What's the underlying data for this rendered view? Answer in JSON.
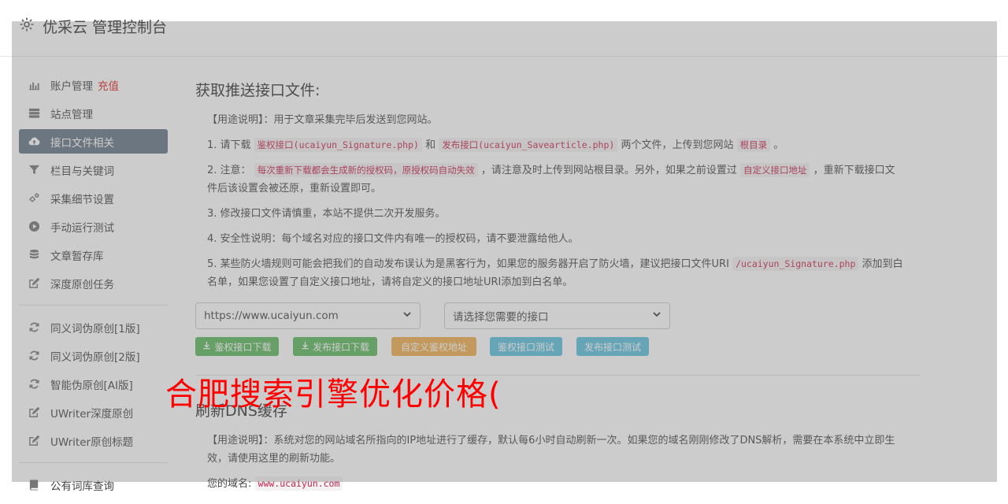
{
  "header": {
    "brand": "优采云 管理控制台"
  },
  "sidebar": {
    "group1": [
      {
        "label": "账户管理",
        "badge": "充值",
        "icon": "bar-chart-icon"
      },
      {
        "label": "站点管理",
        "icon": "server-icon"
      },
      {
        "label": "接口文件相关",
        "icon": "cloud-upload-icon",
        "active": true
      },
      {
        "label": "栏目与关键词",
        "icon": "filter-icon"
      },
      {
        "label": "采集细节设置",
        "icon": "gears-icon"
      },
      {
        "label": "手动运行测试",
        "icon": "play-circle-icon"
      },
      {
        "label": "文章暂存库",
        "icon": "database-icon"
      },
      {
        "label": "深度原创任务",
        "icon": "edit-icon"
      }
    ],
    "group2": [
      {
        "label": "同义词伪原创[1版]",
        "icon": "refresh-icon"
      },
      {
        "label": "同义词伪原创[2版]",
        "icon": "refresh-icon"
      },
      {
        "label": "智能伪原创[AI版]",
        "icon": "refresh-icon"
      },
      {
        "label": "UWriter深度原创",
        "icon": "edit-icon"
      },
      {
        "label": "UWriter原创标题",
        "icon": "edit-icon"
      }
    ],
    "group3": [
      {
        "label": "公有词库查询",
        "icon": "book-icon"
      }
    ]
  },
  "main": {
    "section1": {
      "title": "获取推送接口文件:",
      "usage": "【用途说明】：用于文章采集完毕后发送到您网站。",
      "p1": {
        "a": "1. 请下载",
        "c1": "鉴权接口(ucaiyun_Signature.php)",
        "b": "和",
        "c2": "发布接口(ucaiyun_Savearticle.php)",
        "d": "两个文件，上传到您网站",
        "c3": "根目录",
        "e": "。"
      },
      "p2": {
        "a": "2. 注意：",
        "c1": "每次重新下载都会生成新的授权码，原授权码自动失效",
        "b": "，请注意及时上传到网站根目录。另外，如果之前设置过",
        "c2": "自定义接口地址",
        "c": "，重新下载接口文件后该设置会被还原，重新设置即可。"
      },
      "p3": "3. 修改接口文件请慎重，本站不提供二次开发服务。",
      "p4": "4. 安全性说明：每个域名对应的接口文件内有唯一的授权码，请不要泄露给他人。",
      "p5": {
        "a": "5. 某些防火墙规则可能会把我们的自动发布误认为是黑客行为，如果您的服务器开启了防火墙，建议把接口文件URI",
        "c1": "/ucaiyun_Signature.php",
        "b": "添加到白名单，如果您设置了自定义接口地址，请将自定义的接口地址URI添加到白名单。"
      },
      "site_select": "https://www.ucaiyun.com",
      "interface_select": "请选择您需要的接口",
      "buttons": {
        "auth_download": "鉴权接口下载",
        "publish_download": "发布接口下载",
        "custom_auth": "自定义鉴权地址",
        "auth_test": "鉴权接口测试",
        "publish_test": "发布接口测试"
      }
    },
    "section2": {
      "title": "刷新DNS缓存",
      "usage": "【用途说明】：系统对您的网站域名所指向的IP地址进行了缓存，默认每6小时自动刷新一次。如果您的域名刚刚修改了DNS解析，需要在本系统中立即生效，请使用这里的刷新功能。",
      "domain_label": "您的域名:",
      "domain_value": "www.ucaiyun.com"
    }
  },
  "watermark": "合肥搜索引擎优化价格(",
  "colors": {
    "active_nav": "#647486",
    "badge": "#e02020",
    "code": "#c7254e",
    "watermark": "#ff0000"
  }
}
